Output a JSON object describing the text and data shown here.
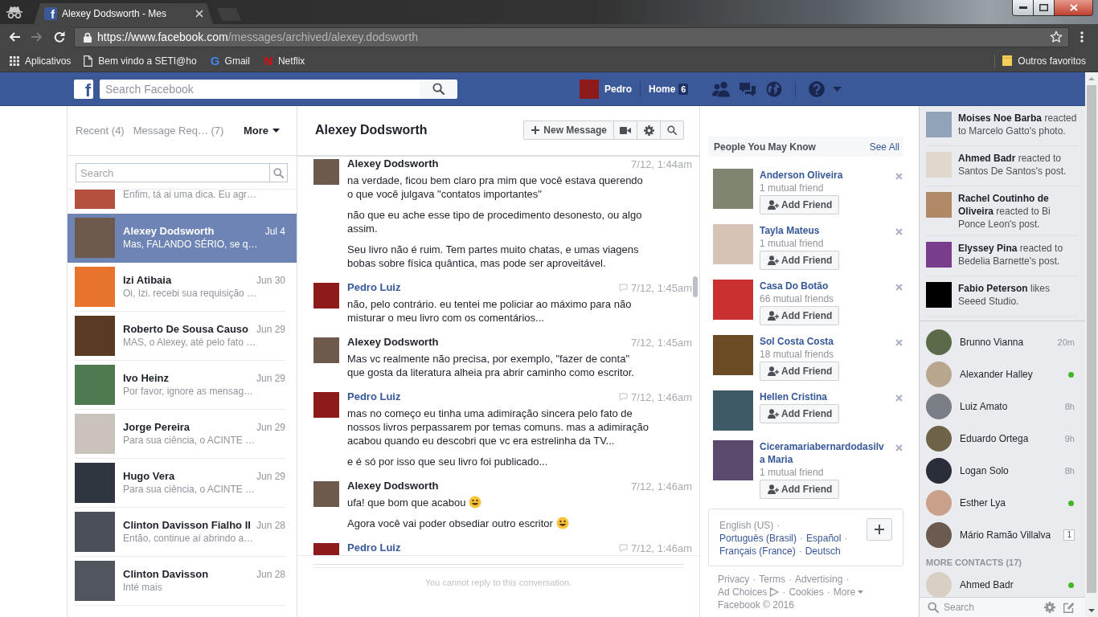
{
  "browser": {
    "tab": {
      "favicon": "f",
      "title": "Alexey Dodsworth - Mes",
      "selected": true
    },
    "nav": [
      {
        "kind": "back",
        "disabled": false
      },
      {
        "kind": "forward",
        "disabled": true
      },
      {
        "kind": "reload",
        "disabled": false
      }
    ],
    "url": {
      "secure": true,
      "origin": "https://www.facebook.com",
      "path": "/messages/archived/alexey.dodsworth"
    },
    "bookmarks": [
      {
        "kind": "apps",
        "label": "Aplicativos"
      },
      {
        "kind": "page",
        "label": "Bem vindo a SETI@ho"
      },
      {
        "kind": "letter",
        "glyph": "G",
        "color": "#4285f4",
        "label": "Gmail"
      },
      {
        "kind": "letter",
        "glyph": "N",
        "color": "#e50914",
        "label": "Netflix"
      }
    ],
    "other_bookmarks": {
      "label": "Outros favoritos"
    }
  },
  "topbar": {
    "logo": "f",
    "search": {
      "placeholder": "Search Facebook"
    },
    "profile": {
      "name": "Pedro"
    },
    "home": {
      "label": "Home",
      "count": "6"
    }
  },
  "threads": {
    "tabs": [
      {
        "kind": "tab",
        "label": "Recent (4)",
        "selected": false
      },
      {
        "kind": "tab",
        "label": "Message Req… (7)",
        "selected": false
      },
      {
        "kind": "menu",
        "label": "More",
        "selected": true
      }
    ],
    "search": {
      "placeholder": "Search"
    },
    "items": [
      {
        "snippet": "Enfim, tá ai uma dica. Eu agr…",
        "selected": false
      },
      {
        "name": "Alexey Dodsworth",
        "date": "Jul 4",
        "snippet": "Mas, FALANDO SÉRIO, se q…",
        "selected": true
      },
      {
        "name": "Izi Atibaia",
        "date": "Jun 30",
        "snippet": "Oi, Izi. recebi sua requisição …",
        "selected": false
      },
      {
        "name": "Roberto De Sousa Causo",
        "date": "Jun 29",
        "snippet": "MAS, o Alexey, até pelo fato …",
        "selected": false
      },
      {
        "name": "Ivo Heinz",
        "date": "Jun 29",
        "snippet": "Por favor, ignore as mensag…",
        "selected": false
      },
      {
        "name": "Jorge Pereira",
        "date": "Jun 29",
        "snippet": "Para sua ciência, o ACINTE …",
        "selected": false
      },
      {
        "name": "Hugo Vera",
        "date": "Jun 29",
        "snippet": "Para sua ciência, o ACINTE …",
        "selected": false
      },
      {
        "name": "Clinton Davisson Fialho II",
        "date": "Jun 28",
        "snippet": "Então, continue aí abrindo a…",
        "selected": false
      },
      {
        "name": "Clinton Davisson",
        "date": "Jun 28",
        "snippet": "Inté mais",
        "selected": false
      }
    ]
  },
  "conversation": {
    "title": "Alexey Dodsworth",
    "new_message": "New Message",
    "messages": [
      {
        "kind": "received",
        "sender": "Alexey Dodsworth",
        "time": "7/12, 1:44am",
        "paragraphs": [
          {
            "text": "na verdade, ficou bem claro pra mim que você estava querendo o que você julgava \"contatos importantes\"",
            "emoji": false
          },
          {
            "text": "não que eu ache esse tipo de procedimento desonesto, ou algo assim.",
            "emoji": false
          },
          {
            "text": "Seu livro não é ruim. Tem partes muito chatas, e umas viagens bobas sobre física quântica, mas pode ser aproveitável.",
            "emoji": false
          }
        ]
      },
      {
        "kind": "sent",
        "sender": "Pedro Luiz",
        "time": "7/12, 1:45am",
        "paragraphs": [
          {
            "text": "não, pelo contrário. eu tentei me policiar ao máximo para não misturar o meu livro com os comentários...",
            "emoji": false
          }
        ]
      },
      {
        "kind": "received",
        "sender": "Alexey Dodsworth",
        "time": "7/12, 1:45am",
        "paragraphs": [
          {
            "text": "Mas vc realmente não precisa, por exemplo, \"fazer de conta\" que gosta da literatura alheia pra abrir caminho como escritor.",
            "emoji": false
          }
        ]
      },
      {
        "kind": "sent",
        "sender": "Pedro Luiz",
        "time": "7/12, 1:46am",
        "paragraphs": [
          {
            "text": "mas no começo eu tinha uma adimiração sincera pelo fato de nossos livros perpassarem por temas comuns. mas a adimiração acabou quando eu descobri que vc era estrelinha da TV...",
            "emoji": false
          },
          {
            "text": "e é só por isso que seu livro foi publicado...",
            "emoji": false
          }
        ]
      },
      {
        "kind": "received",
        "sender": "Alexey Dodsworth",
        "time": "7/12, 1:46am",
        "paragraphs": [
          {
            "text": "ufa! que bom que acabou",
            "emoji": true
          },
          {
            "text": "Agora você vai poder obsediar outro escritor",
            "emoji": true
          }
        ]
      },
      {
        "kind": "sent",
        "sender": "Pedro Luiz",
        "time": "7/12, 1:46am"
      }
    ],
    "notice": "You cannot reply to this conversation."
  },
  "people_you_may_know": {
    "title": "People You May Know",
    "see_all": "See All",
    "people": [
      {
        "name": "Anderson Oliveira",
        "mutual": "1 mutual friend",
        "action": "Add Friend"
      },
      {
        "name": "Tayla Mateus",
        "mutual": "1 mutual friend",
        "action": "Add Friend"
      },
      {
        "name": "Casa Do Botão",
        "mutual": "66 mutual friends",
        "action": "Add Friend"
      },
      {
        "name": "Sol Costa Costa",
        "mutual": "18 mutual friends",
        "action": "Add Friend"
      },
      {
        "name": "Hellen Cristina",
        "action": "Add Friend"
      },
      {
        "name": "Ciceramariabernardodasilva Maria",
        "mutual": "1 mutual friend",
        "action": "Add Friend"
      }
    ]
  },
  "languages": {
    "items": [
      {
        "label": "English (US)",
        "current": true,
        "sep": "·"
      },
      {
        "label": "Português (Brasil)",
        "current": false,
        "sep": "·"
      },
      {
        "label": "Español",
        "current": false,
        "sep": "·"
      },
      {
        "label": "Français (France)",
        "current": false,
        "sep": "·"
      },
      {
        "label": "Deutsch",
        "current": false
      }
    ]
  },
  "footer": {
    "links": [
      {
        "kind": "link",
        "label": "Privacy",
        "sep": "·"
      },
      {
        "kind": "link",
        "label": "Terms",
        "sep": "·"
      },
      {
        "kind": "link",
        "label": "Advertising",
        "sep": "·"
      },
      {
        "kind": "adchoices",
        "label": "Ad Choices",
        "sep": "·"
      },
      {
        "kind": "link",
        "label": "Cookies",
        "sep": "·"
      },
      {
        "kind": "menu",
        "label": "More"
      }
    ],
    "copyright": "Facebook © 2016"
  },
  "sidebar": {
    "ticker": [
      {
        "text": "**Moises Noe Barba** reacted to Marcelo Gatto's photo."
      },
      {
        "text": "**Ahmed Badr** reacted to Santos De Santos's post."
      },
      {
        "text": "**Rachel Coutinho de Oliveira** reacted to Bi Ponce Leon's post."
      },
      {
        "text": "**Elyssey Pina** reacted to Bedelia Barnette's post."
      },
      {
        "text": "**Fabio Peterson** likes Seeed Studio."
      }
    ],
    "contacts": [
      {
        "name": "Brunno Vianna",
        "online": false,
        "last_active": "20m"
      },
      {
        "name": "Alexander Halley",
        "online": true
      },
      {
        "name": "Luiz Amato",
        "online": false,
        "last_active": "8h"
      },
      {
        "name": "Eduardo Ortega",
        "online": false,
        "last_active": "9h"
      },
      {
        "name": "Logan Solo",
        "online": false,
        "last_active": "8h"
      },
      {
        "name": "Esther Lya",
        "online": true
      },
      {
        "name": "Mário Ramão Villalva",
        "online": false,
        "count": "1"
      }
    ],
    "more_contacts": {
      "title": "MORE CONTACTS (17)",
      "contacts": [
        {
          "name": "Ahmed Badr",
          "online": true
        }
      ]
    },
    "search": {
      "placeholder": "Search"
    }
  }
}
